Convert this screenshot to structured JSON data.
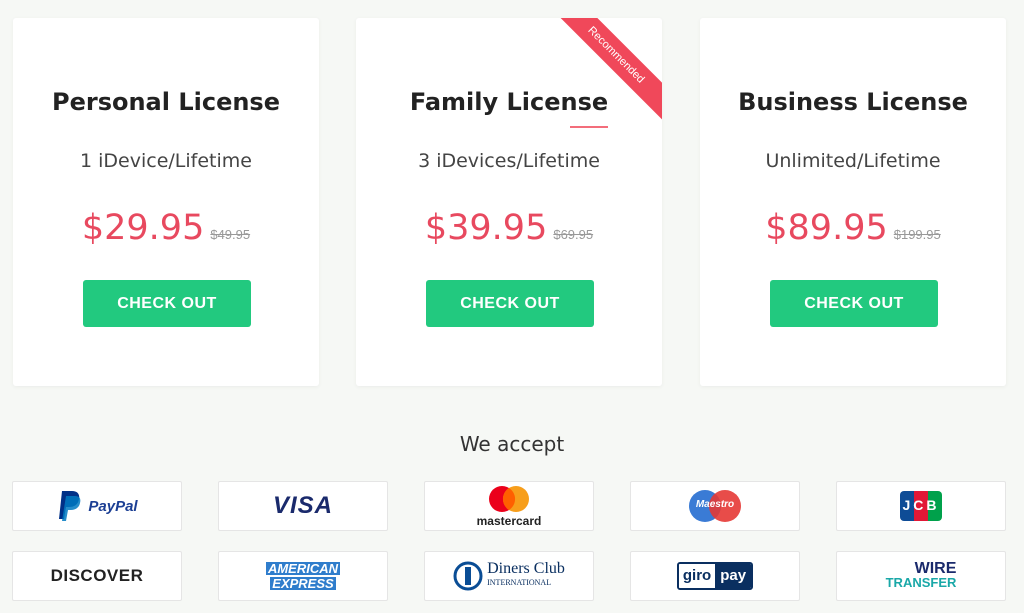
{
  "plans": [
    {
      "title": "Personal License",
      "devices": "1 iDevice/Lifetime",
      "price": "$29.95",
      "old_price": "$49.95",
      "button": "CHECK OUT"
    },
    {
      "title": "Family License",
      "devices": "3 iDevices/Lifetime",
      "price": "$39.95",
      "old_price": "$69.95",
      "button": "CHECK OUT",
      "badge": "Recommended"
    },
    {
      "title": "Business License",
      "devices": "Unlimited/Lifetime",
      "price": "$89.95",
      "old_price": "$199.95",
      "button": "CHECK OUT"
    }
  ],
  "accept_title": "We accept",
  "payment_logos": {
    "paypal": "PayPal",
    "visa": "VISA",
    "mastercard": "mastercard",
    "maestro": "Maestro",
    "jcb": "JCB",
    "discover": "DISCOVER",
    "amex_line1": "AMERICAN",
    "amex_line2": "EXPRESS",
    "diners_line1": "Diners Club",
    "diners_line2": "INTERNATIONAL",
    "giro": "giro",
    "pay": "pay",
    "wire_line1": "WIRE",
    "wire_line2": "TRANSFER"
  },
  "colors": {
    "accent": "#22c97f",
    "price": "#e8495f",
    "ribbon": "#f0485a"
  }
}
